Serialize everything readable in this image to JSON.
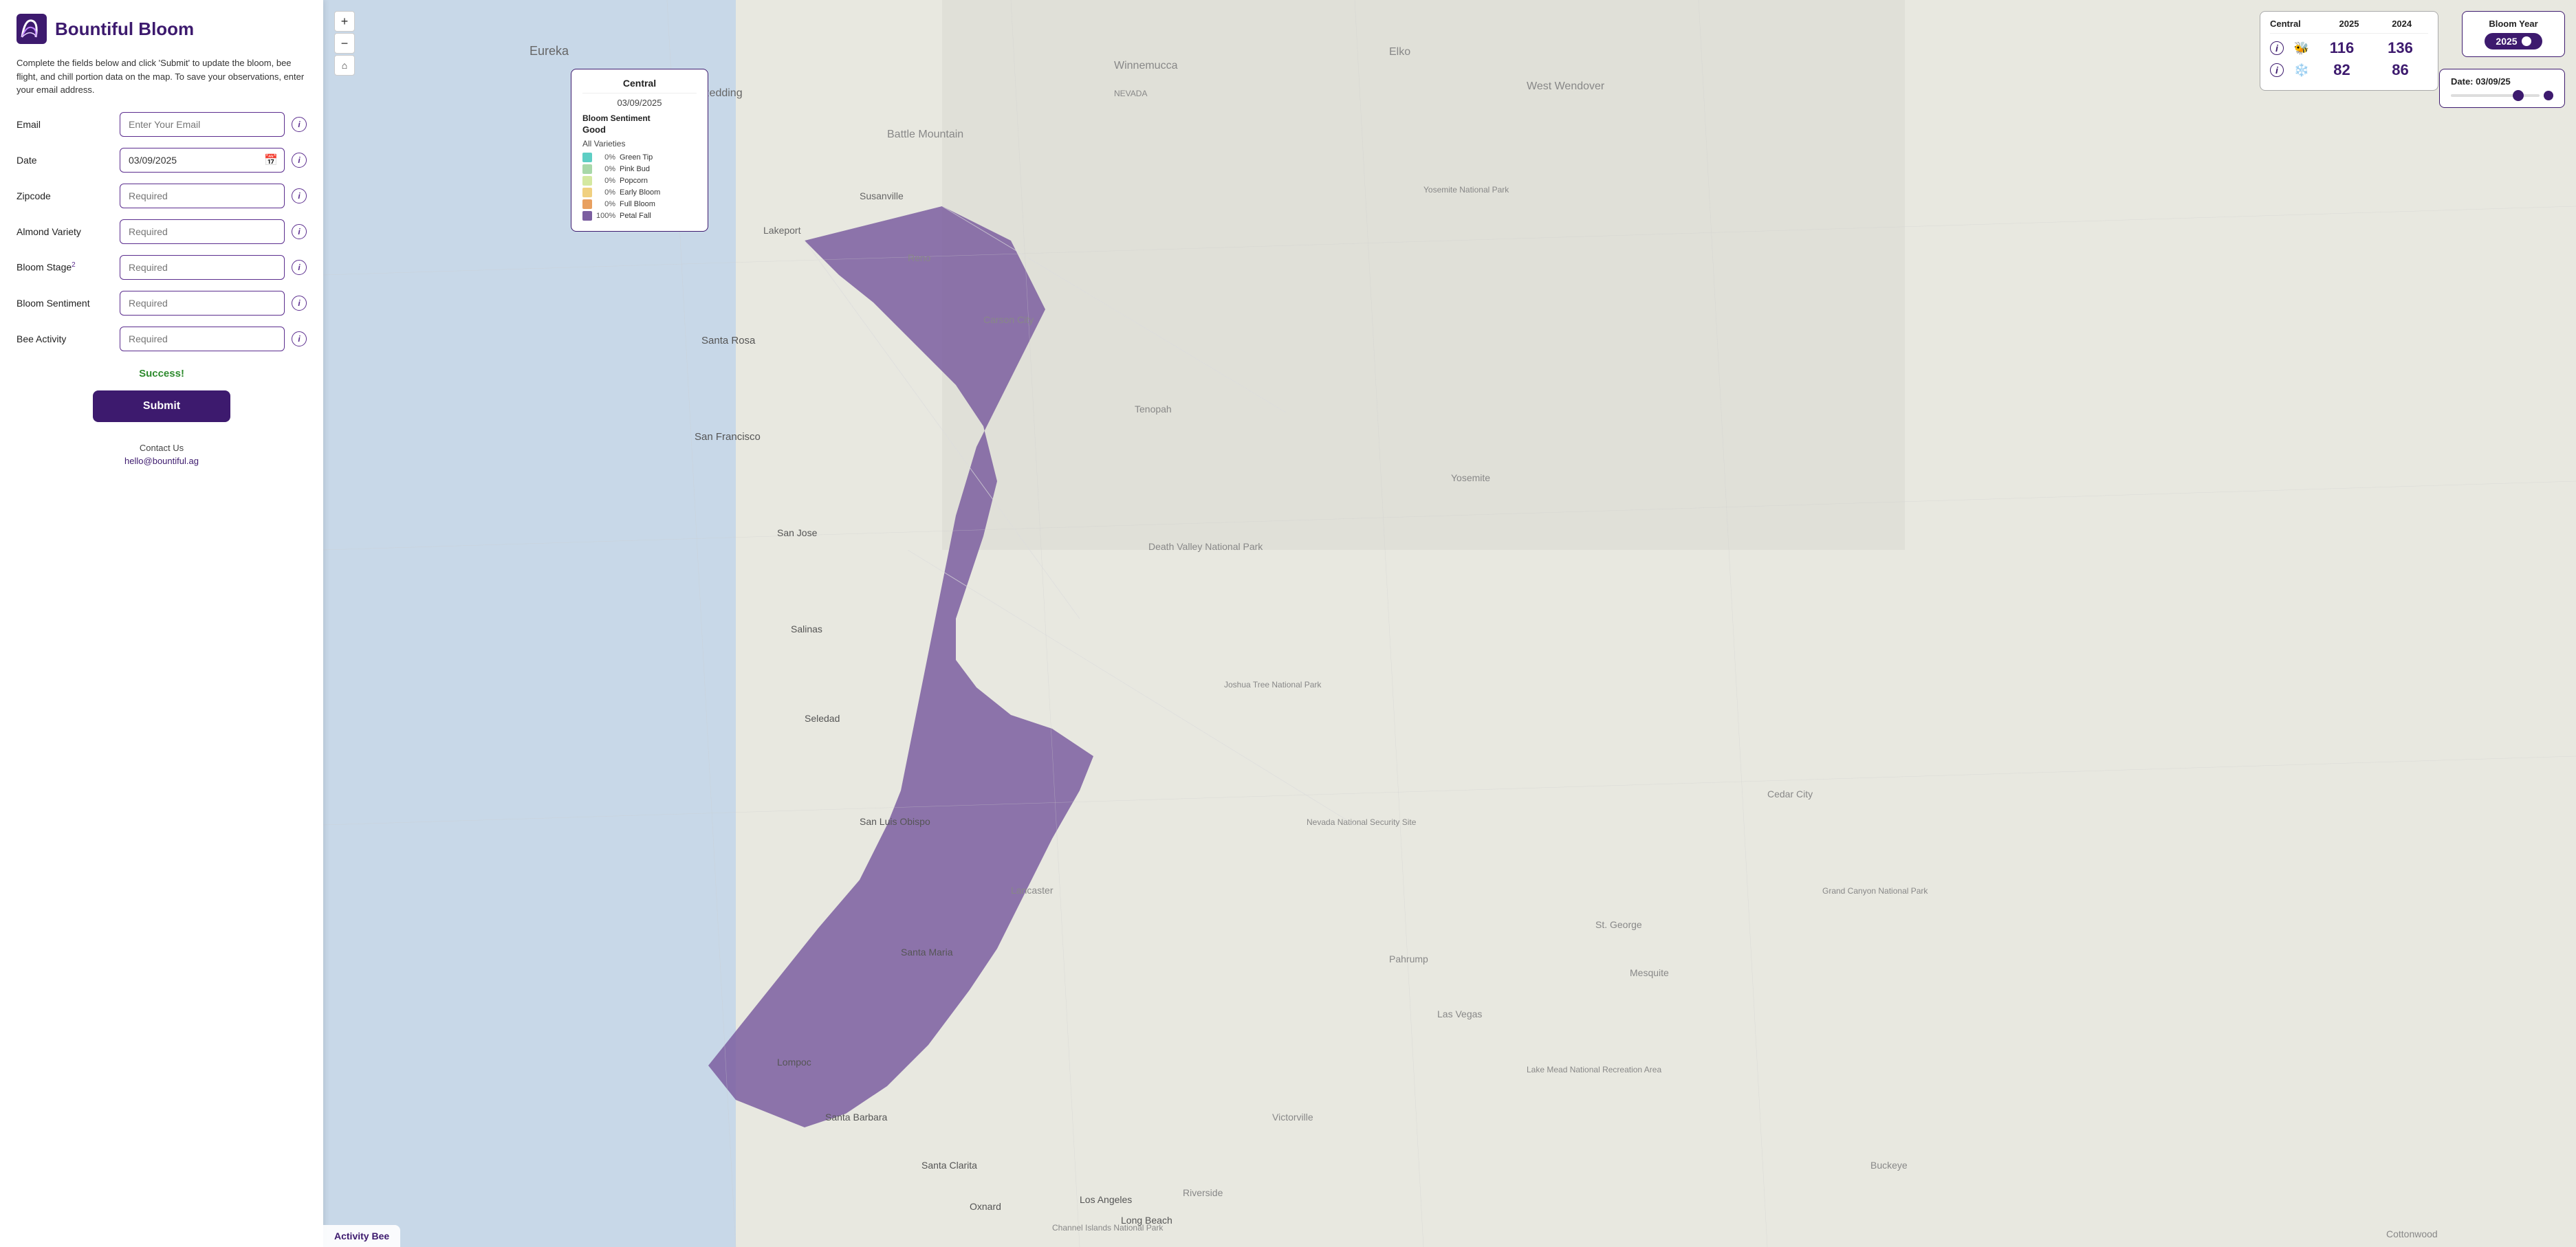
{
  "app": {
    "title": "Bountiful Bloom"
  },
  "description": "Complete the fields below and click 'Submit' to update the bloom, bee flight, and chill portion data on the map. To save your observations, enter your email address.",
  "form": {
    "email_label": "Email",
    "email_placeholder": "Enter Your Email",
    "date_label": "Date",
    "date_value": "03/09/2025",
    "zipcode_label": "Zipcode",
    "zipcode_placeholder": "Required",
    "almond_variety_label": "Almond Variety",
    "almond_variety_placeholder": "Required",
    "bloom_stage_label": "Bloom Stage",
    "bloom_stage_superscript": "2",
    "bloom_stage_placeholder": "Required",
    "bloom_sentiment_label": "Bloom Sentiment",
    "bloom_sentiment_placeholder": "Required",
    "bee_activity_label": "Bee Activity",
    "bee_activity_placeholder": "Required",
    "success_text": "Success!",
    "submit_label": "Submit"
  },
  "contact": {
    "label": "Contact Us",
    "email": "hello@bountiful.ag"
  },
  "map": {
    "zoom_in": "+",
    "zoom_out": "−",
    "home_icon": "⌂"
  },
  "bloom_year_widget": {
    "label": "Bloom Year",
    "year": "2025"
  },
  "date_widget": {
    "label": "Date: 03/09/25"
  },
  "central_popup": {
    "region": "Central",
    "date": "03/09/2025",
    "bloom_sentiment_label": "Bloom Sentiment",
    "bloom_sentiment_value": "Good",
    "varieties_label": "All Varieties",
    "bloom_stages": [
      {
        "pct": "0%",
        "name": "Green Tip",
        "color": "#5ecec4"
      },
      {
        "pct": "0%",
        "name": "Pink Bud",
        "color": "#a8d8a8"
      },
      {
        "pct": "0%",
        "name": "Popcorn",
        "color": "#d4e8a0"
      },
      {
        "pct": "0%",
        "name": "Early Bloom",
        "color": "#f0d080"
      },
      {
        "pct": "0%",
        "name": "Full Bloom",
        "color": "#e8a060"
      },
      {
        "pct": "100%",
        "name": "Petal Fall",
        "color": "#7b5ea0"
      }
    ]
  },
  "stats_card": {
    "region": "Central",
    "year1": "2025",
    "year2": "2024",
    "rows": [
      {
        "icon1": "ℹ",
        "icon2": "🐝",
        "val1": "116",
        "val2": "136"
      },
      {
        "icon1": "ℹ",
        "icon2": "❄",
        "val1": "82",
        "val2": "86"
      }
    ]
  },
  "activity_bee": {
    "label": "Activity Bee"
  }
}
